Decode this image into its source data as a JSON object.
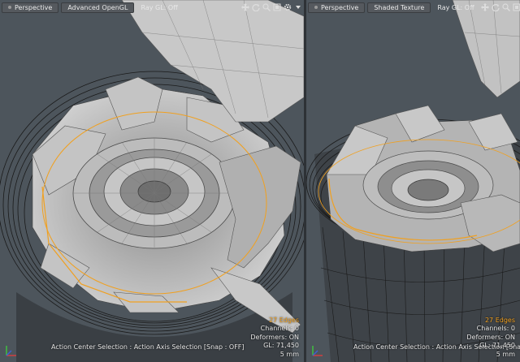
{
  "colors": {
    "accent": "#f0a020",
    "wire": "#1a1a1a",
    "surface": "#b8b8b8"
  },
  "left_viewport": {
    "view_button": "Perspective",
    "shading_button": "Advanced OpenGL",
    "raygl_button": "Ray GL: Off",
    "icons": [
      "move-icon",
      "rotate-icon",
      "zoom-icon",
      "fit-icon",
      "settings-icon",
      "dropdown-icon"
    ],
    "hud": {
      "selection": "27 Edges",
      "channels": "Channels: 0",
      "deformers": "Deformers: ON",
      "gl": "GL: 71,450",
      "scale": "5 mm"
    },
    "status": "Action Center Selection : Action Axis Selection  [Snap : OFF]"
  },
  "right_viewport": {
    "view_button": "Perspective",
    "shading_button": "Shaded Texture",
    "raygl_button": "Ray GL: Off",
    "icons": [
      "move-icon",
      "rotate-icon",
      "zoom-icon",
      "fit-icon",
      "settings-icon"
    ],
    "hud": {
      "selection": "27 Edges",
      "channels": "Channels: 0",
      "deformers": "Deformers: ON",
      "gl": "GL: 71,450",
      "scale": "5 mm"
    },
    "status": "Action Center Selection : Action Axis Selection  [Snap : OFF]"
  }
}
